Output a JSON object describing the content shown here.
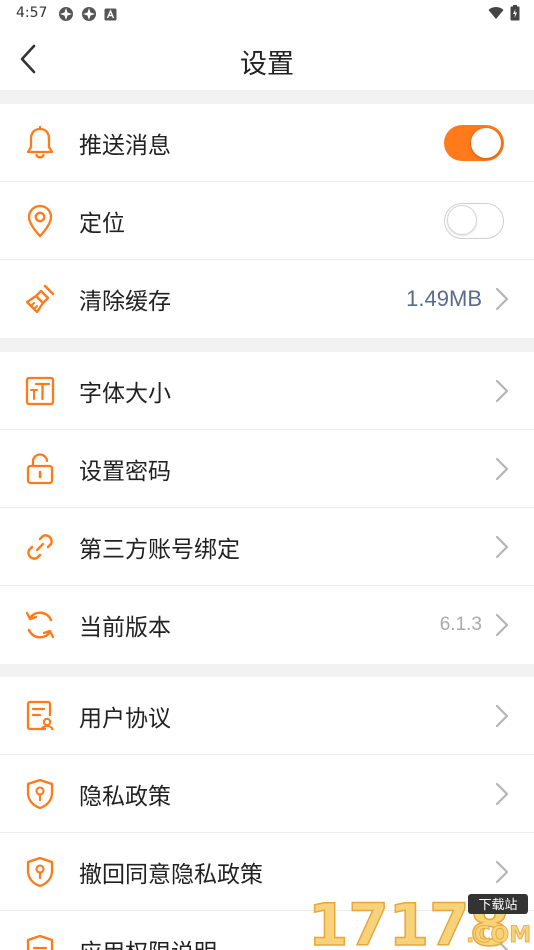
{
  "status_bar": {
    "time": "4:57"
  },
  "header": {
    "title": "设置"
  },
  "sections": [
    {
      "rows": [
        {
          "label": "推送消息",
          "icon": "bell-icon",
          "toggle": true
        },
        {
          "label": "定位",
          "icon": "location-pin-icon",
          "toggle": false
        },
        {
          "label": "清除缓存",
          "icon": "broom-icon",
          "value": "1.49MB"
        }
      ]
    },
    {
      "rows": [
        {
          "label": "字体大小",
          "icon": "font-size-icon"
        },
        {
          "label": "设置密码",
          "icon": "unlock-icon"
        },
        {
          "label": "第三方账号绑定",
          "icon": "link-icon"
        },
        {
          "label": "当前版本",
          "icon": "refresh-icon",
          "value": "6.1.3"
        }
      ]
    },
    {
      "rows": [
        {
          "label": "用户协议",
          "icon": "document-user-icon"
        },
        {
          "label": "隐私政策",
          "icon": "shield-lock-icon"
        },
        {
          "label": "撤回同意隐私政策",
          "icon": "shield-lock-icon"
        },
        {
          "label": "应用权限说明",
          "icon": "permission-icon"
        }
      ]
    }
  ],
  "accent_color": "#ff7a1a",
  "watermark": {
    "text": "17178",
    "domain": ".COM",
    "tag": "下载站"
  }
}
